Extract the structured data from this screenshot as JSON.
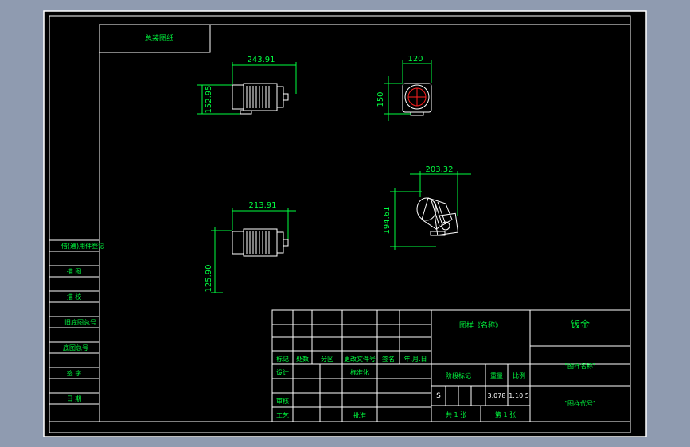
{
  "app": {
    "background_color": "#8f9bb0",
    "sheet_color": "#000000",
    "frame_color": "#ffffff",
    "dimension_color": "#00ff40",
    "label_color": "#00ff40",
    "part_color": "#ffffff",
    "accent_red": "#ff2020"
  },
  "header_box": {
    "text": "总装图纸"
  },
  "views": {
    "front": {
      "width_dim": "243.91",
      "height_dim": "152.95"
    },
    "side": {
      "width_dim": "120",
      "height_dim": "150"
    },
    "iso": {
      "width_dim": "203.32",
      "height_dim": "194.61"
    },
    "top": {
      "width_dim": "213.91",
      "height_dim": "125.90"
    }
  },
  "left_strip": {
    "labels": [
      "借(通)用件登记",
      "描 图",
      "描 校",
      "旧底图总号",
      "底图总号",
      "签 字",
      "日 期"
    ]
  },
  "title_block": {
    "revision_headers": [
      "标记",
      "处数",
      "分区",
      "更改文件号",
      "签名",
      "年.月.日"
    ],
    "signature_rows": [
      "设计",
      "标准化",
      "审核",
      "工艺",
      "批准"
    ],
    "material_label": "图样《名称》",
    "company": "钣金",
    "drawing_name": "\"图样名称\"",
    "drawing_code": "\"图样代号\"",
    "stage_labels": [
      "阶段标记",
      "重量",
      "比例"
    ],
    "stage_mark": "S",
    "weight": "3.078",
    "scale": "1:10.5",
    "sheets_total": "共 1 张",
    "sheet_number": "第 1 张"
  }
}
